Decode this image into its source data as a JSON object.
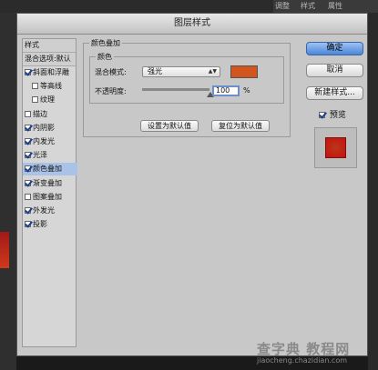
{
  "background": {
    "panel_tabs": [
      "调整",
      "样式",
      "属性"
    ]
  },
  "dialog": {
    "title": "图层样式"
  },
  "styles_panel": {
    "header": "样式",
    "blend_options": "混合选项:默认",
    "items": [
      {
        "label": "斜面和浮雕",
        "checked": true,
        "indent": false,
        "selected": false
      },
      {
        "label": "等高线",
        "checked": false,
        "indent": true,
        "selected": false
      },
      {
        "label": "纹理",
        "checked": false,
        "indent": true,
        "selected": false
      },
      {
        "label": "描边",
        "checked": false,
        "indent": false,
        "selected": false
      },
      {
        "label": "内阴影",
        "checked": true,
        "indent": false,
        "selected": false
      },
      {
        "label": "内发光",
        "checked": true,
        "indent": false,
        "selected": false
      },
      {
        "label": "光泽",
        "checked": true,
        "indent": false,
        "selected": false
      },
      {
        "label": "颜色叠加",
        "checked": true,
        "indent": false,
        "selected": true
      },
      {
        "label": "渐变叠加",
        "checked": true,
        "indent": false,
        "selected": false
      },
      {
        "label": "图案叠加",
        "checked": false,
        "indent": false,
        "selected": false
      },
      {
        "label": "外发光",
        "checked": true,
        "indent": false,
        "selected": false
      },
      {
        "label": "投影",
        "checked": true,
        "indent": false,
        "selected": false
      }
    ]
  },
  "color_overlay": {
    "group_title": "颜色叠加",
    "sub_title": "颜色",
    "blend_mode_label": "混合模式:",
    "blend_mode_value": "强光",
    "color_swatch": "#d2551e",
    "opacity_label": "不透明度:",
    "opacity_value": "100",
    "opacity_fraction": 1.0,
    "opacity_unit": "%",
    "set_default": "设置为默认值",
    "reset_default": "复位为默认值"
  },
  "actions": {
    "ok": "确定",
    "cancel": "取消",
    "new_style": "新建样式...",
    "preview_label": "预览",
    "preview_checked": true
  },
  "watermark": {
    "line1": "查字典 教程网",
    "line2": "jiaocheng.chazidian.com"
  }
}
